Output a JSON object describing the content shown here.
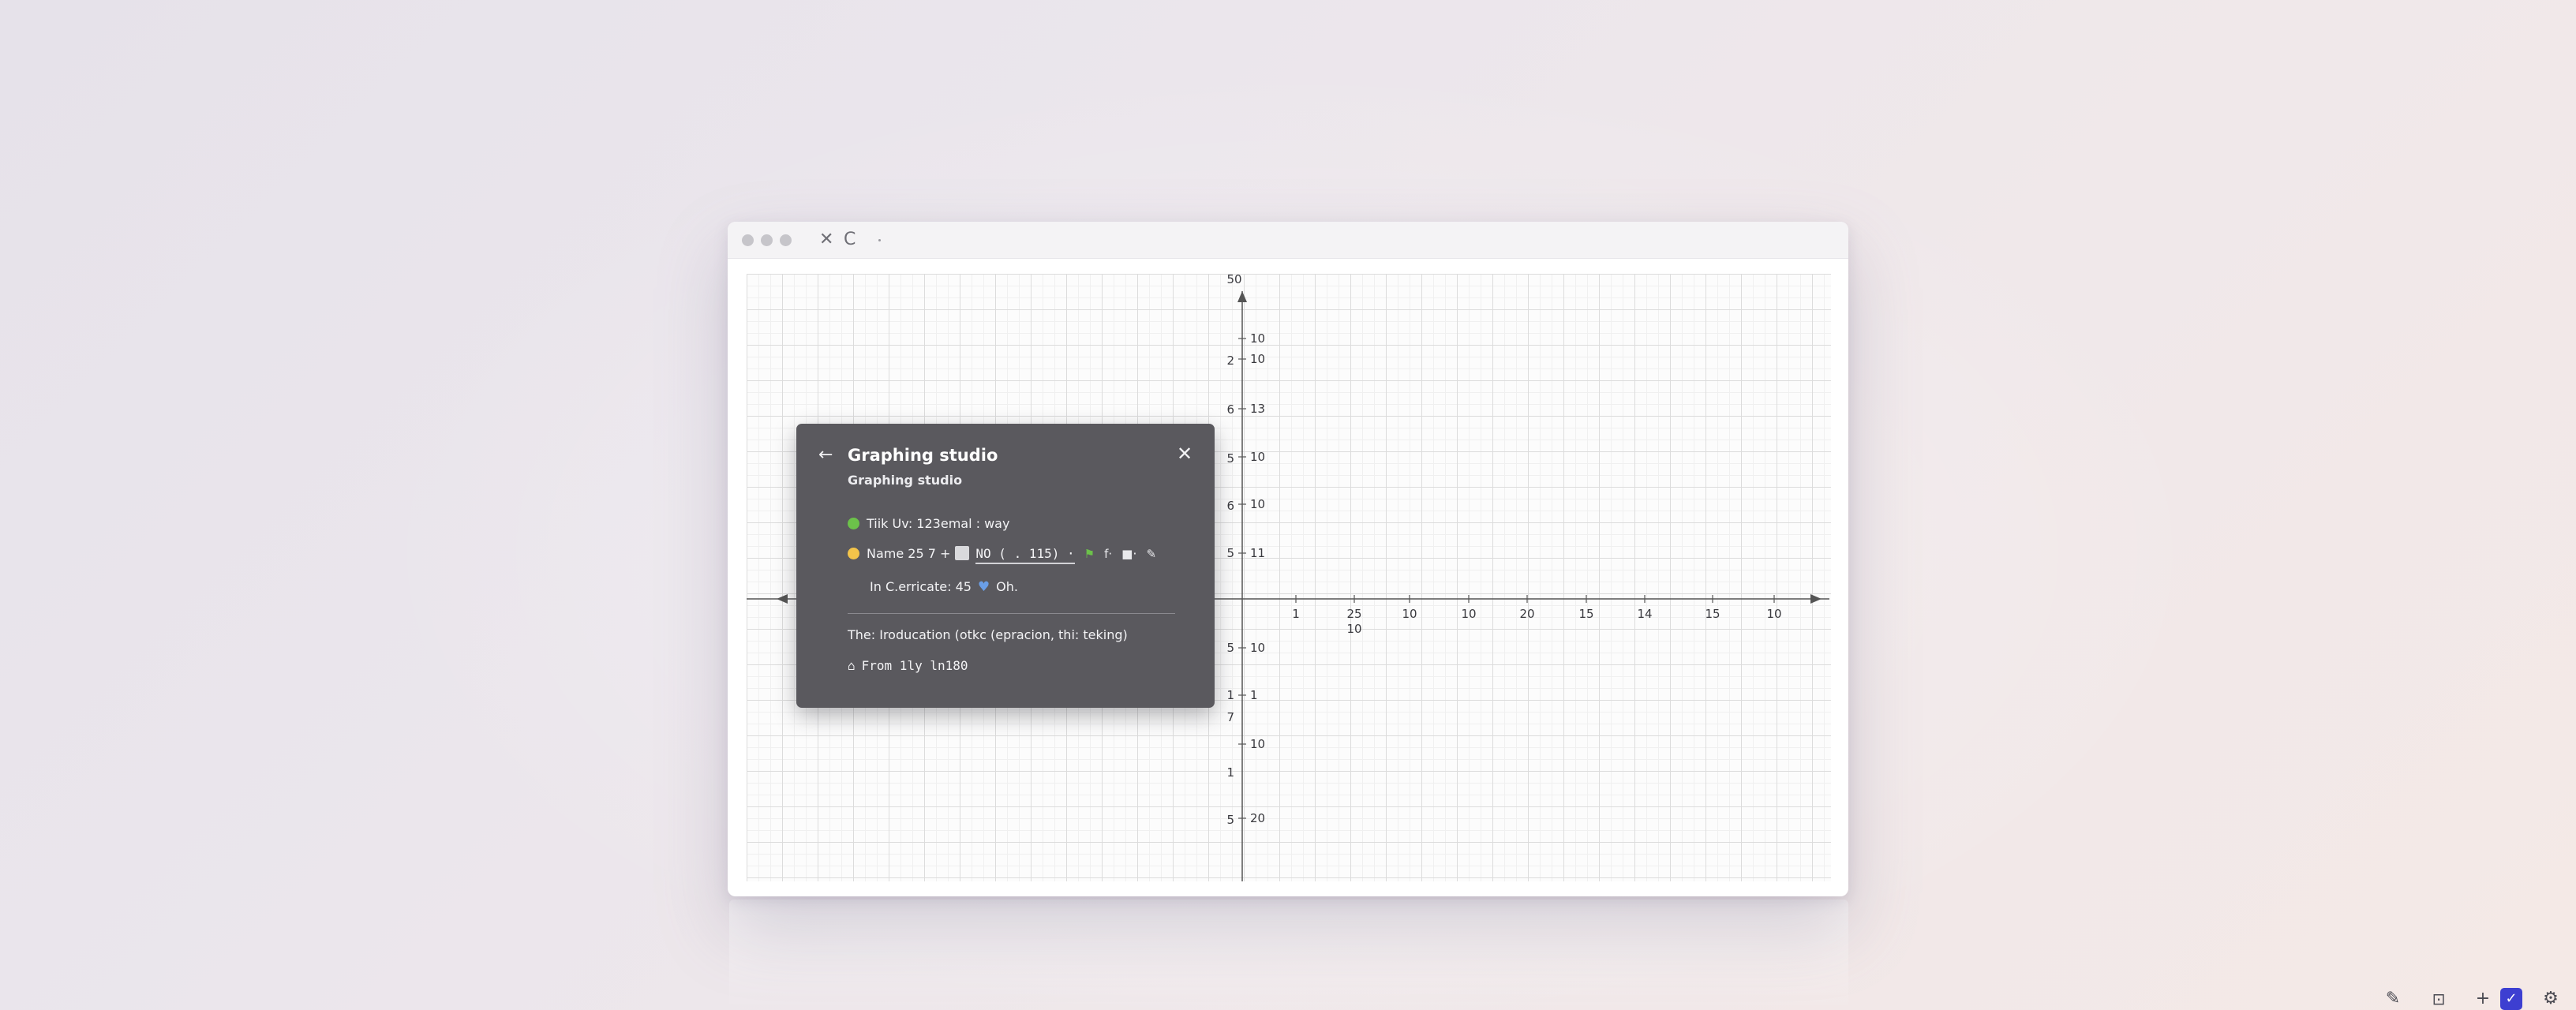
{
  "window": {
    "controls": {
      "close_glyph": "✕",
      "refresh_glyph": "C"
    }
  },
  "graph": {
    "x_tick_labels": [
      "10",
      "1",
      "25",
      "10",
      "10",
      "20",
      "15",
      "14",
      "15",
      "10"
    ],
    "y_top_label": "50",
    "y_tick_labels_left": [
      "2",
      "6",
      "5",
      "6",
      "5",
      "5",
      "1",
      "7",
      "1",
      "5"
    ],
    "y_tick_labels_right": [
      "10",
      "10",
      "13",
      "10",
      "10",
      "11",
      "10",
      "1",
      "10",
      "20"
    ],
    "grid": true
  },
  "panel": {
    "title": "Graphing studio",
    "subtitle": "Graphing studio",
    "row1": {
      "text": "Tiik Uv: 123emal :  way",
      "dot_color": "#6cc24a"
    },
    "row2": {
      "dot_color": "#f3c44a",
      "name_text": "Name 25  7 +",
      "field_text": "NO  ( . 115) ·",
      "f_text": "f·",
      "extra_text": "·"
    },
    "row3": {
      "text_before": "In C.erricate: 45",
      "text_after": "Oh."
    },
    "row4": {
      "text": "The: Iroducation (otkc (epracion, thi: teking)"
    },
    "row5": {
      "text": "From 1ly ln180"
    }
  },
  "bottom_toolbar": {
    "buttons": [
      "draw-tool",
      "export",
      "add",
      "check",
      "settings"
    ]
  }
}
